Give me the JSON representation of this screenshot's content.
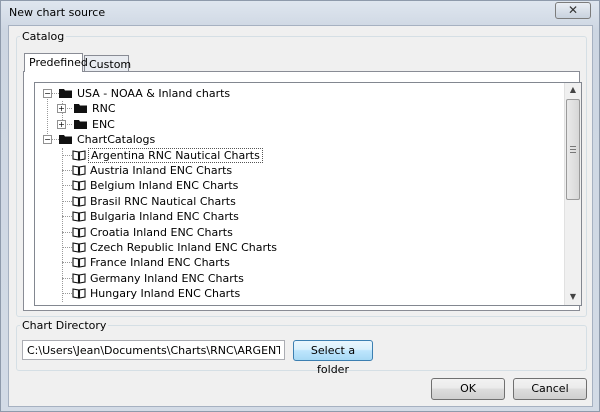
{
  "window": {
    "title": "New chart source",
    "close_glyph": "✕"
  },
  "catalog": {
    "group_label": "Catalog",
    "tabs": [
      {
        "label": "Predefined",
        "active": true
      },
      {
        "label": "Custom",
        "active": false
      }
    ],
    "tree": [
      {
        "label": "USA - NOAA & Inland charts",
        "level": 0,
        "type": "folder",
        "expander": "−"
      },
      {
        "label": "RNC",
        "level": 1,
        "type": "folder",
        "expander": "+"
      },
      {
        "label": "ENC",
        "level": 1,
        "type": "folder",
        "expander": "+"
      },
      {
        "label": "ChartCatalogs",
        "level": 0,
        "type": "folder",
        "expander": "−"
      },
      {
        "label": "Argentina RNC Nautical Charts",
        "level": 1,
        "type": "book",
        "selected": true
      },
      {
        "label": "Austria Inland ENC Charts",
        "level": 1,
        "type": "book"
      },
      {
        "label": "Belgium Inland ENC Charts",
        "level": 1,
        "type": "book"
      },
      {
        "label": "Brasil RNC Nautical Charts",
        "level": 1,
        "type": "book"
      },
      {
        "label": "Bulgaria Inland ENC Charts",
        "level": 1,
        "type": "book"
      },
      {
        "label": "Croatia Inland ENC Charts",
        "level": 1,
        "type": "book"
      },
      {
        "label": "Czech Republic Inland ENC Charts",
        "level": 1,
        "type": "book"
      },
      {
        "label": "France Inland ENC Charts",
        "level": 1,
        "type": "book"
      },
      {
        "label": "Germany Inland ENC Charts",
        "level": 1,
        "type": "book"
      },
      {
        "label": "Hungary Inland ENC Charts",
        "level": 1,
        "type": "book"
      }
    ]
  },
  "chart_directory": {
    "group_label": "Chart Directory",
    "path_value": "C:\\Users\\Jean\\Documents\\Charts\\RNC\\ARGENTINA",
    "select_button": "Select a folder"
  },
  "buttons": {
    "ok": "OK",
    "cancel": "Cancel"
  },
  "icons": {
    "expander_collapsed": "plus-box-icon",
    "expander_expanded": "minus-box-icon",
    "folder": "folder-icon",
    "catalog": "open-book-icon"
  }
}
